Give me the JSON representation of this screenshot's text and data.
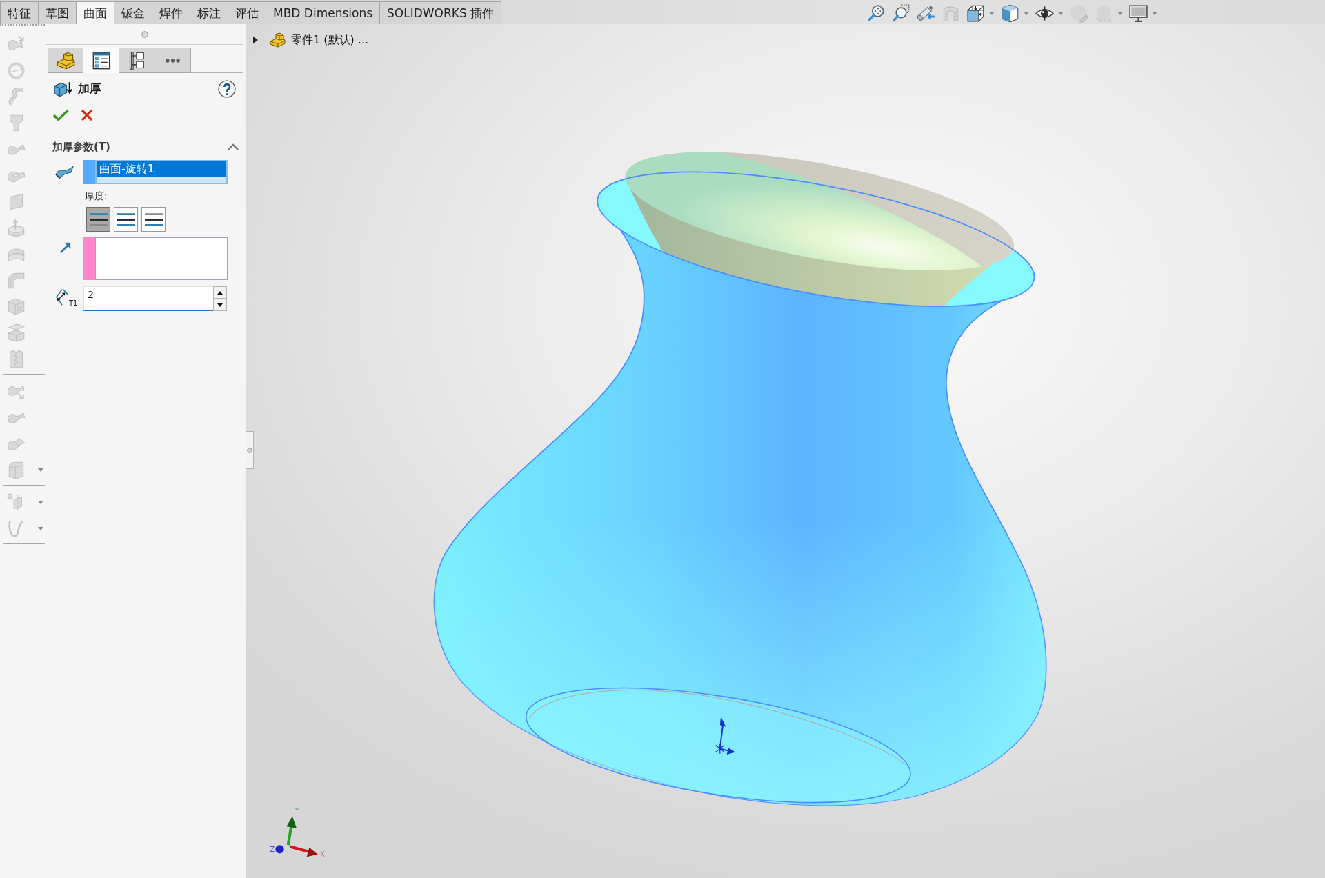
{
  "command_tabs": [
    {
      "label": "特征",
      "selected": false
    },
    {
      "label": "草图",
      "selected": false
    },
    {
      "label": "曲面",
      "selected": true
    },
    {
      "label": "钣金",
      "selected": false
    },
    {
      "label": "焊件",
      "selected": false
    },
    {
      "label": "标注",
      "selected": false
    },
    {
      "label": "评估",
      "selected": false
    },
    {
      "label": "MBD Dimensions",
      "selected": false
    },
    {
      "label": "SOLIDWORKS 插件",
      "selected": false
    }
  ],
  "view_toolbar": [
    {
      "disabled": false,
      "dropdown": false
    },
    {
      "disabled": false,
      "dropdown": false
    },
    {
      "disabled": false,
      "dropdown": false
    },
    {
      "disabled": true,
      "dropdown": false
    },
    {
      "disabled": false,
      "dropdown": true
    },
    {
      "disabled": false,
      "dropdown": true
    },
    {
      "disabled": false,
      "dropdown": true
    },
    {
      "disabled": true,
      "dropdown": false
    },
    {
      "disabled": true,
      "dropdown": true
    },
    {
      "disabled": false,
      "dropdown": true
    }
  ],
  "left_toolbar": {
    "groups": [
      [
        {
          "disabled": true,
          "dropdown": false
        },
        {
          "disabled": true,
          "dropdown": false
        },
        {
          "disabled": true,
          "dropdown": false
        },
        {
          "disabled": true,
          "dropdown": false
        },
        {
          "disabled": true,
          "dropdown": false
        },
        {
          "disabled": true,
          "dropdown": false
        },
        {
          "disabled": true,
          "dropdown": false
        },
        {
          "disabled": true,
          "dropdown": false
        },
        {
          "disabled": true,
          "dropdown": false
        },
        {
          "disabled": true,
          "dropdown": false
        },
        {
          "disabled": true,
          "dropdown": false
        },
        {
          "disabled": true,
          "dropdown": false
        },
        {
          "disabled": true,
          "dropdown": false
        }
      ],
      [
        {
          "disabled": true,
          "dropdown": false
        },
        {
          "disabled": true,
          "dropdown": false
        },
        {
          "disabled": true,
          "dropdown": false
        },
        {
          "disabled": true,
          "dropdown": true
        }
      ],
      [
        {
          "disabled": true,
          "dropdown": true
        },
        {
          "disabled": true,
          "dropdown": true
        }
      ]
    ]
  },
  "panel": {
    "tabs": [
      {
        "selected": false
      },
      {
        "selected": true
      },
      {
        "selected": false
      },
      {
        "selected": false
      }
    ],
    "title": "加厚",
    "section": {
      "title": "加厚参数(T)",
      "expanded": true,
      "surface_selection": {
        "color": "#55aaff",
        "items": [
          {
            "label": "曲面-旋转1",
            "selected": true
          }
        ]
      },
      "thickness_label": "厚度:",
      "thickness_sides": [
        {
          "selected": true
        },
        {
          "selected": false
        },
        {
          "selected": false
        }
      ],
      "direction_selection": {
        "color": "#ff88cc"
      },
      "thickness": {
        "symbol": "T1",
        "value": "2"
      }
    }
  },
  "feature_tree": {
    "expanded": false,
    "label": "零件1 (默认) ..."
  },
  "triad": {
    "x": "X",
    "y": "Y",
    "z": "Z"
  }
}
